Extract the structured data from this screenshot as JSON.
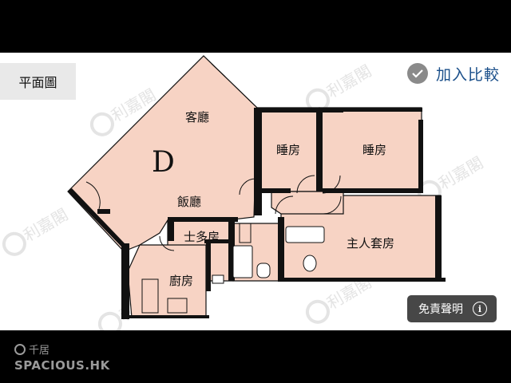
{
  "header": {
    "title": "平面圖"
  },
  "compare": {
    "label": "加入比較",
    "icon": "check-circle-icon"
  },
  "floorplan": {
    "unit_letter": "D",
    "rooms": {
      "living": "客廳",
      "dining": "飯廳",
      "bedroom1": "睡房",
      "bedroom2": "睡房",
      "master": "主人套房",
      "maid": "士多房",
      "kitchen": "廚房"
    },
    "fill_color": "#f7d3c4",
    "watermark": "利嘉閣"
  },
  "disclaimer": {
    "label": "免責聲明"
  },
  "branding": {
    "cn": "千居",
    "en": "SPACIOUS.HK"
  }
}
